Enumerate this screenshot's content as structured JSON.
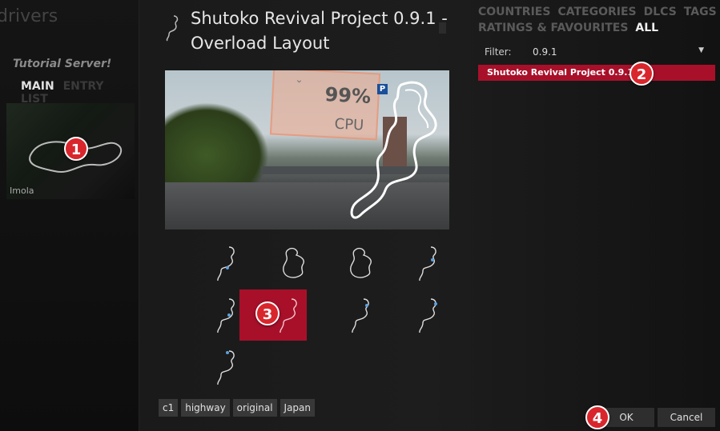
{
  "left_panel": {
    "heading": "drivers",
    "server_name": "Tutorial Server!",
    "tabs": [
      {
        "label": "MAIN",
        "active": true
      },
      {
        "label": "ENTRY LIST",
        "active": false
      }
    ],
    "track_thumbnail": {
      "label": "Imola"
    }
  },
  "dialog": {
    "title": "Shutoko Revival Project 0.9.1 - Overload Layout",
    "preview": {
      "cpu_percent": "99%",
      "cpu_label": "CPU",
      "parking_label": "P"
    },
    "layouts": [
      {
        "icon": "track-layout-icon",
        "selected": false
      },
      {
        "icon": "track-layout-icon",
        "selected": false
      },
      {
        "icon": "track-layout-icon",
        "selected": false
      },
      {
        "icon": "track-layout-icon",
        "selected": false
      },
      {
        "icon": "track-layout-icon",
        "selected": false
      },
      {
        "icon": "track-layout-icon",
        "selected": true
      },
      {
        "icon": "track-layout-icon",
        "selected": false
      },
      {
        "icon": "track-layout-icon",
        "selected": false
      },
      {
        "icon": "track-layout-icon",
        "selected": false
      }
    ],
    "tags": [
      "c1",
      "highway",
      "original",
      "Japan"
    ],
    "buttons": {
      "ok": "OK",
      "cancel": "Cancel"
    }
  },
  "filter_panel": {
    "categories": [
      {
        "label": "COUNTRIES",
        "active": false
      },
      {
        "label": "CATEGORIES",
        "active": false
      },
      {
        "label": "DLCS",
        "active": false
      },
      {
        "label": "TAGS",
        "active": false
      },
      {
        "label": "RATINGS & FAVOURITES",
        "active": false
      },
      {
        "label": "ALL",
        "active": true
      }
    ],
    "filter_label": "Filter:",
    "filter_value": "0.9.1",
    "results": [
      {
        "label": "Shutoko Revival Project 0.9.1 (9)",
        "selected": true
      }
    ]
  },
  "callouts": [
    "1",
    "2",
    "3",
    "4"
  ],
  "colors": {
    "accent": "#a8102a",
    "callout": "#d8262c",
    "background": "#111111"
  }
}
